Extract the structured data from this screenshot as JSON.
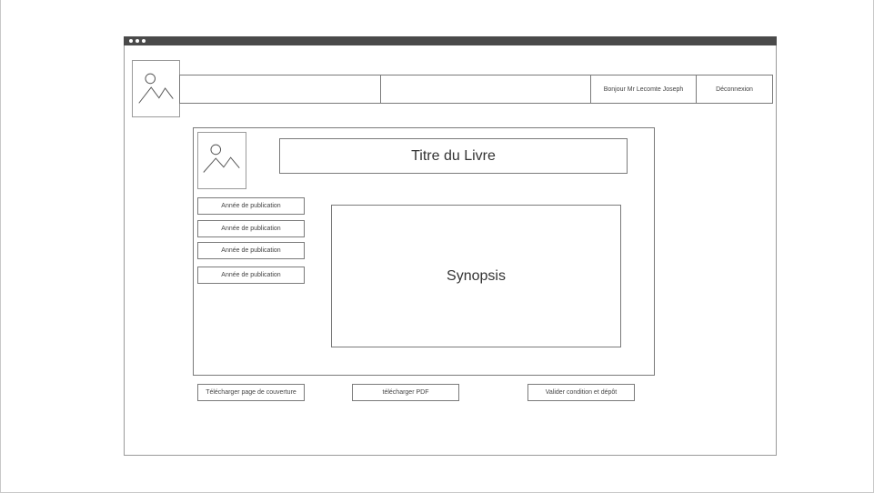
{
  "header": {
    "nav_cells": [
      "",
      ""
    ],
    "greeting": "Bonjour Mr Lecomte  Joseph",
    "logout_label": "Déconnexion"
  },
  "book": {
    "title": "Titre du Livre",
    "synopsis": "Synopsis",
    "fields": [
      "Année de publication",
      "Année de publication",
      "Année de publication",
      "Année de publication"
    ]
  },
  "actions": {
    "download_cover": "Télécharger page de couverture",
    "download_pdf": "télécharger PDF",
    "validate": "Valider condition et  dépôt"
  },
  "icons": {
    "logo": "image-placeholder-icon",
    "cover": "image-placeholder-icon"
  }
}
